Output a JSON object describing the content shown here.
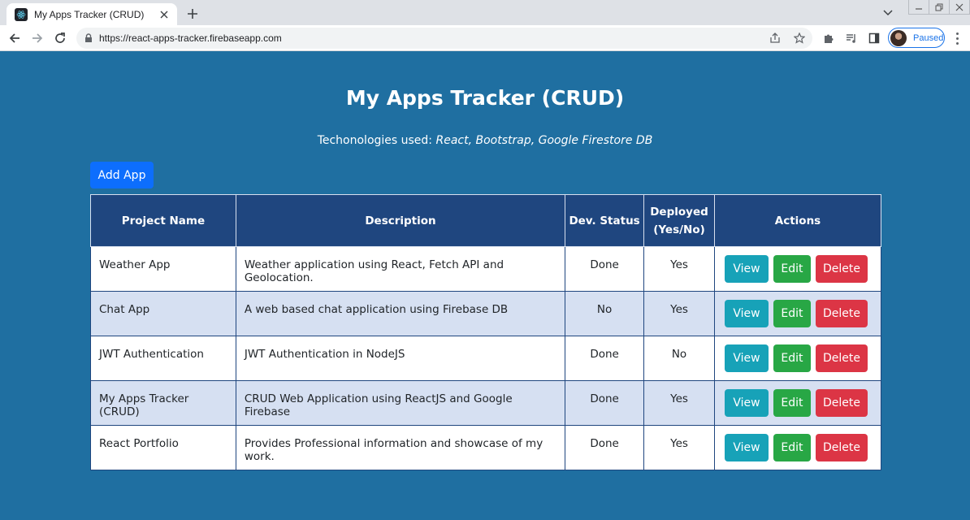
{
  "browser": {
    "tab_title": "My Apps Tracker (CRUD)",
    "url": "https://react-apps-tracker.firebaseapp.com",
    "profile_label": "Paused",
    "icons": [
      "react-favicon",
      "back-arrow-icon",
      "forward-arrow-icon",
      "reload-icon",
      "lock-icon",
      "share-icon",
      "star-icon",
      "extensions-icon",
      "media-queue-icon",
      "side-panel-icon",
      "kebab-menu-icon"
    ]
  },
  "page": {
    "title": "My Apps Tracker (CRUD)",
    "subtitle_prefix": "Techonologies used: ",
    "subtitle_tech": "React, Bootstrap, Google Firestore DB",
    "add_button": "Add App"
  },
  "table": {
    "headers": {
      "name": "Project Name",
      "description": "Description",
      "status": "Dev. Status",
      "deployed_line1": "Deployed",
      "deployed_line2": "(Yes/No)",
      "actions": "Actions"
    },
    "rows": [
      {
        "name": "Weather App",
        "description": "Weather application using React, Fetch API and Geolocation.",
        "status": "Done",
        "deployed": "Yes"
      },
      {
        "name": "Chat App",
        "description": "A web based chat application using Firebase DB",
        "status": "No",
        "deployed": "Yes"
      },
      {
        "name": "JWT Authentication",
        "description": "JWT Authentication in NodeJS",
        "status": "Done",
        "deployed": "No"
      },
      {
        "name": "My Apps Tracker (CRUD)",
        "description": "CRUD Web Application using ReactJS and Google Firebase",
        "status": "Done",
        "deployed": "Yes"
      },
      {
        "name": "React Portfolio",
        "description": "Provides Professional information and showcase of my work.",
        "status": "Done",
        "deployed": "Yes"
      }
    ],
    "actions": {
      "view": "View",
      "edit": "Edit",
      "delete": "Delete"
    }
  },
  "colors": {
    "page_bg": "#1f6fa1",
    "header_bg": "#1f467f",
    "row_alt_bg": "#d6e0f2",
    "add_btn": "#0d6efd",
    "view_btn": "#17a2b8",
    "edit_btn": "#28a745",
    "delete_btn": "#dc3545"
  }
}
